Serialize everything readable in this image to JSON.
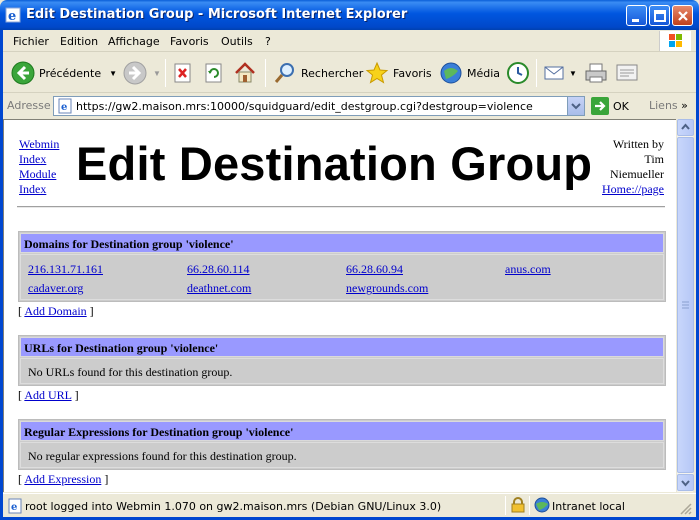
{
  "window": {
    "title": "Edit Destination Group - Microsoft Internet Explorer"
  },
  "menu": [
    "Fichier",
    "Edition",
    "Affichage",
    "Favoris",
    "Outils",
    "?"
  ],
  "toolbar": {
    "back_label": "Précédente",
    "search_label": "Rechercher",
    "favorites_label": "Favoris",
    "media_label": "Média"
  },
  "address": {
    "label": "Adresse",
    "url": "https://gw2.maison.mrs:10000/squidguard/edit_destgroup.cgi?destgroup=violence",
    "go_label": "OK",
    "links_label": "Liens"
  },
  "page": {
    "nav_left": [
      "Webmin",
      "Index",
      "Module",
      "Index"
    ],
    "title": "Edit Destination Group",
    "author_lines": [
      "Written by",
      "Tim",
      "Niemueller"
    ],
    "author_link": "Home://page"
  },
  "domains": {
    "header": "Domains for Destination group 'violence'",
    "items": [
      "216.131.71.161",
      "66.28.60.114",
      "66.28.60.94",
      "anus.com",
      "cadaver.org",
      "deathnet.com",
      "newgrounds.com"
    ],
    "add_link": "Add Domain"
  },
  "urls": {
    "header": "URLs for Destination group 'violence'",
    "empty_text": "No URLs found for this destination group.",
    "add_link": "Add URL"
  },
  "regex": {
    "header": "Regular Expressions for Destination group 'violence'",
    "empty_text": "No regular expressions found for this destination group.",
    "add_link": "Add Expression"
  },
  "status": {
    "text": "root logged into Webmin 1.070 on gw2.maison.mrs (Debian GNU/Linux 3.0)",
    "zone": "Intranet local"
  }
}
